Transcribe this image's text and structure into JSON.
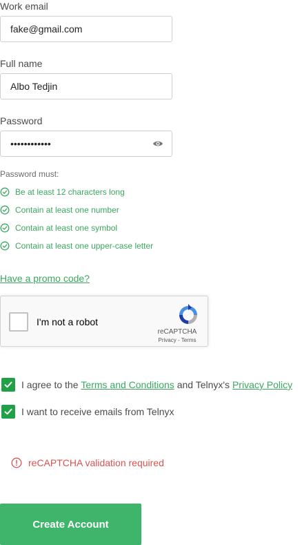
{
  "form": {
    "email_label": "Work email",
    "email_value": "fake@gmail.com",
    "name_label": "Full name",
    "name_value": "Albo Tedjin",
    "password_label": "Password",
    "password_value": "••••••••••••"
  },
  "password_rules": {
    "title": "Password must:",
    "items": [
      "Be at least 12 characters long",
      "Contain at least one number",
      "Contain at least one symbol",
      "Contain at least one upper-case letter"
    ]
  },
  "promo_link": "Have a promo code?",
  "recaptcha": {
    "label": "I'm not a robot",
    "brand": "reCAPTCHA",
    "privacy": "Privacy",
    "separator": "-",
    "terms": "Terms"
  },
  "agreements": {
    "terms_prefix": "I agree to the ",
    "terms_link": "Terms and Conditions",
    "terms_middle": " and Telnyx's ",
    "privacy_link": "Privacy Policy",
    "emails_label": "I want to receive emails from Telnyx"
  },
  "error_message": "reCAPTCHA validation required",
  "submit_label": "Create Account",
  "colors": {
    "accent": "#3aa85e",
    "button": "#3fb46b",
    "checkbox": "#21a048",
    "error": "#d9534f"
  }
}
